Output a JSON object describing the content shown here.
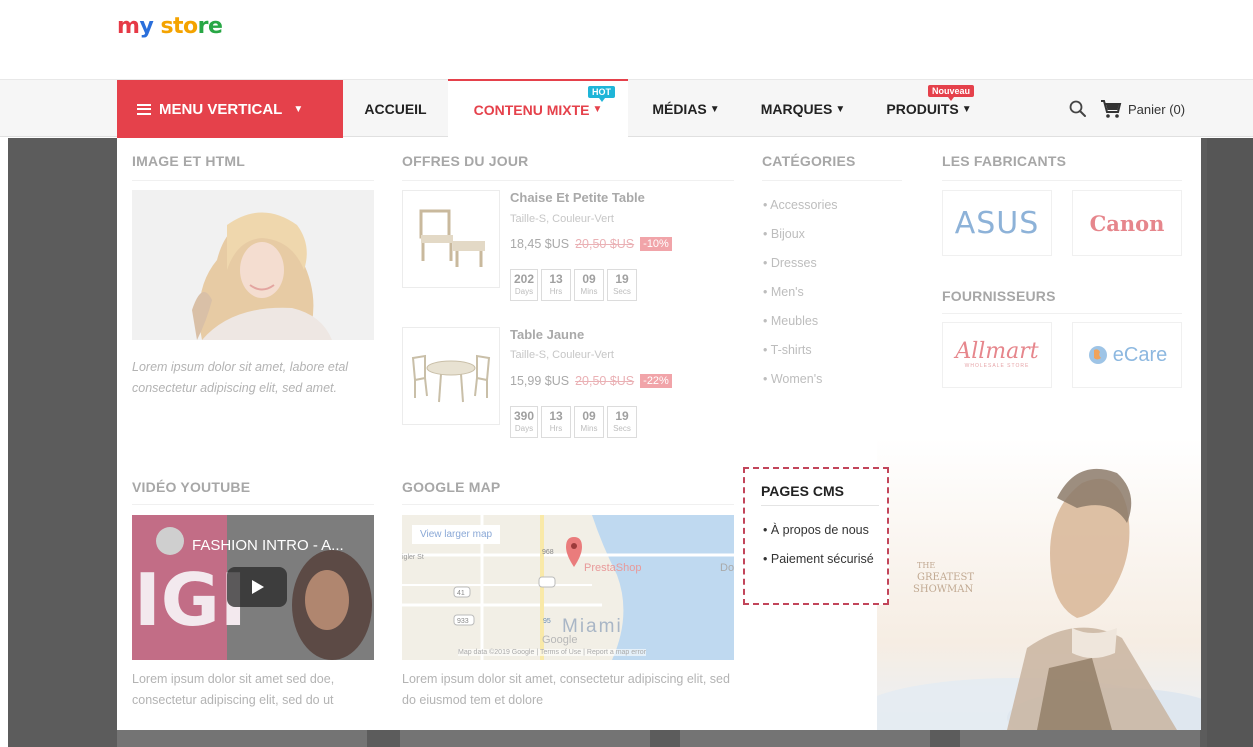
{
  "logo": {
    "text_1": "m",
    "text_2": "y",
    "text_3": " sto",
    "text_4": "re"
  },
  "nav": {
    "vertical_menu": "MENU VERTICAL",
    "items": [
      {
        "label": "ACCUEIL"
      },
      {
        "label": "CONTENU MIXTE",
        "badge": "HOT"
      },
      {
        "label": "MÉDIAS"
      },
      {
        "label": "MARQUES"
      },
      {
        "label": "PRODUITS",
        "badge": "Nouveau"
      }
    ],
    "cart_label": "Panier (0)"
  },
  "menu": {
    "image_html": {
      "title": "IMAGE ET HTML",
      "text": "Lorem ipsum dolor sit amet, labore etal consectetur adipiscing elit, sed amet."
    },
    "deals": {
      "title": "OFFRES DU JOUR",
      "products": [
        {
          "name": "Chaise Et Petite Table",
          "attributes": "Taille-S, Couleur-Vert",
          "price": "18,45 $US",
          "old_price": "20,50 $US",
          "discount": "-10%",
          "countdown": [
            {
              "value": "202",
              "unit": "Days"
            },
            {
              "value": "13",
              "unit": "Hrs"
            },
            {
              "value": "09",
              "unit": "Mins"
            },
            {
              "value": "19",
              "unit": "Secs"
            }
          ]
        },
        {
          "name": "Table Jaune",
          "attributes": "Taille-S, Couleur-Vert",
          "price": "15,99 $US",
          "old_price": "20,50 $US",
          "discount": "-22%",
          "countdown": [
            {
              "value": "390",
              "unit": "Days"
            },
            {
              "value": "13",
              "unit": "Hrs"
            },
            {
              "value": "09",
              "unit": "Mins"
            },
            {
              "value": "19",
              "unit": "Secs"
            }
          ]
        }
      ]
    },
    "categories": {
      "title": "CATÉGORIES",
      "items": [
        "Accessories",
        "Bijoux",
        "Dresses",
        "Men's",
        "Meubles",
        "T-shirts",
        "Women's"
      ]
    },
    "manufacturers": {
      "title": "LES FABRICANTS",
      "brands": [
        "ASUS",
        "Canon"
      ]
    },
    "suppliers": {
      "title": "FOURNISSEURS",
      "brands": [
        "Allmart",
        "eCare"
      ],
      "allmart_tagline": "WHOLESALE STORE"
    },
    "video": {
      "title": "VIDÉO YOUTUBE",
      "video_title": "FASHION INTRO - A...",
      "text": "Lorem ipsum dolor sit amet sed doe, consectetur adipiscing elit, sed do ut"
    },
    "map": {
      "title": "GOOGLE MAP",
      "link": "View larger map",
      "pin_label": "PrestaShop",
      "city": "Miami",
      "google": "Google",
      "footer": "Map data ©2019 Google | Terms of Use | Report a map error",
      "text": "Lorem ipsum dolor sit amet, consectetur adipiscing elit, sed do eiusmod tem et dolore",
      "road_labels": [
        "968",
        "41",
        "933",
        "95"
      ],
      "partial_labels": [
        "igler St",
        "Do"
      ]
    },
    "cms": {
      "title": "PAGES CMS",
      "items": [
        "À propos de nous",
        "Paiement sécurisé"
      ]
    },
    "poster": {
      "line1": "THE",
      "line2": "GREATEST",
      "line3": "SHOWMAN"
    }
  },
  "colors": {
    "accent": "#e5414b",
    "hot_badge": "#1fb5d8",
    "cms_border": "#c2455a"
  }
}
